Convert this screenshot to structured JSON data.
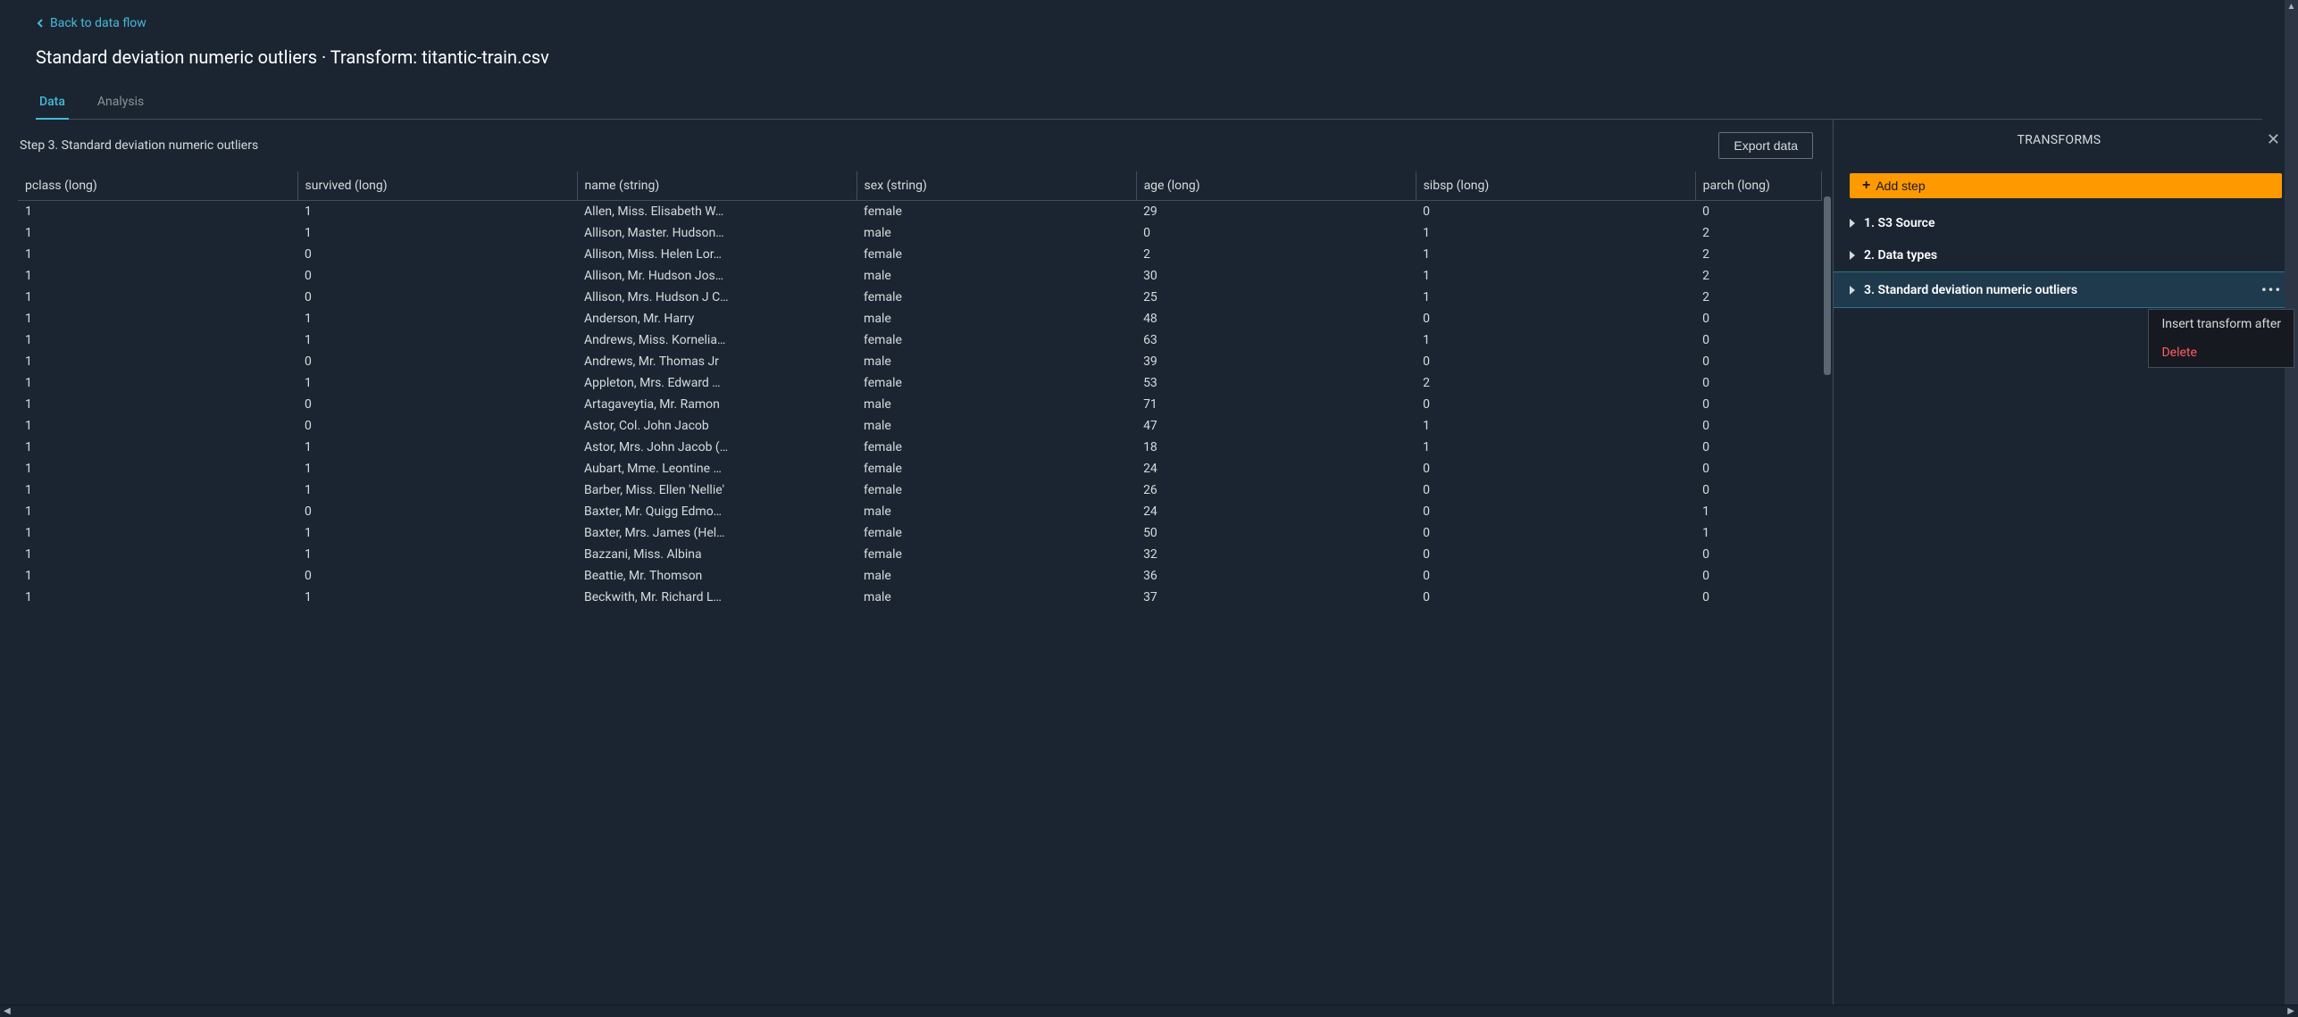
{
  "back_label": "Back to data flow",
  "page_title": "Standard deviation numeric outliers · Transform: titantic-train.csv",
  "tabs": {
    "data": "Data",
    "analysis": "Analysis"
  },
  "step_heading": "Step 3. Standard deviation numeric outliers",
  "buttons": {
    "export": "Export data",
    "add_step": "Add step"
  },
  "transforms_title": "TRANSFORMS",
  "steps": [
    {
      "label": "1. S3 Source"
    },
    {
      "label": "2. Data types"
    },
    {
      "label": "3. Standard deviation numeric outliers"
    }
  ],
  "context_menu": {
    "insert": "Insert transform after",
    "delete": "Delete"
  },
  "columns": [
    "pclass (long)",
    "survived (long)",
    "name (string)",
    "sex (string)",
    "age (long)",
    "sibsp (long)",
    "parch (long)"
  ],
  "rows": [
    {
      "pclass": "1",
      "survived": "1",
      "name": "Allen, Miss. Elisabeth W…",
      "sex": "female",
      "age": "29",
      "sibsp": "0",
      "parch": "0"
    },
    {
      "pclass": "1",
      "survived": "1",
      "name": "Allison, Master. Hudson…",
      "sex": "male",
      "age": "0",
      "sibsp": "1",
      "parch": "2"
    },
    {
      "pclass": "1",
      "survived": "0",
      "name": "Allison, Miss. Helen Lor…",
      "sex": "female",
      "age": "2",
      "sibsp": "1",
      "parch": "2"
    },
    {
      "pclass": "1",
      "survived": "0",
      "name": "Allison, Mr. Hudson Jos…",
      "sex": "male",
      "age": "30",
      "sibsp": "1",
      "parch": "2"
    },
    {
      "pclass": "1",
      "survived": "0",
      "name": "Allison, Mrs. Hudson J C…",
      "sex": "female",
      "age": "25",
      "sibsp": "1",
      "parch": "2"
    },
    {
      "pclass": "1",
      "survived": "1",
      "name": "Anderson, Mr. Harry",
      "sex": "male",
      "age": "48",
      "sibsp": "0",
      "parch": "0"
    },
    {
      "pclass": "1",
      "survived": "1",
      "name": "Andrews, Miss. Kornelia…",
      "sex": "female",
      "age": "63",
      "sibsp": "1",
      "parch": "0"
    },
    {
      "pclass": "1",
      "survived": "0",
      "name": "Andrews, Mr. Thomas Jr",
      "sex": "male",
      "age": "39",
      "sibsp": "0",
      "parch": "0"
    },
    {
      "pclass": "1",
      "survived": "1",
      "name": "Appleton, Mrs. Edward …",
      "sex": "female",
      "age": "53",
      "sibsp": "2",
      "parch": "0"
    },
    {
      "pclass": "1",
      "survived": "0",
      "name": "Artagaveytia, Mr. Ramon",
      "sex": "male",
      "age": "71",
      "sibsp": "0",
      "parch": "0"
    },
    {
      "pclass": "1",
      "survived": "0",
      "name": "Astor, Col. John Jacob",
      "sex": "male",
      "age": "47",
      "sibsp": "1",
      "parch": "0"
    },
    {
      "pclass": "1",
      "survived": "1",
      "name": "Astor, Mrs. John Jacob (…",
      "sex": "female",
      "age": "18",
      "sibsp": "1",
      "parch": "0"
    },
    {
      "pclass": "1",
      "survived": "1",
      "name": "Aubart, Mme. Leontine …",
      "sex": "female",
      "age": "24",
      "sibsp": "0",
      "parch": "0"
    },
    {
      "pclass": "1",
      "survived": "1",
      "name": "Barber, Miss. Ellen 'Nellie'",
      "sex": "female",
      "age": "26",
      "sibsp": "0",
      "parch": "0"
    },
    {
      "pclass": "1",
      "survived": "0",
      "name": "Baxter, Mr. Quigg Edmo…",
      "sex": "male",
      "age": "24",
      "sibsp": "0",
      "parch": "1"
    },
    {
      "pclass": "1",
      "survived": "1",
      "name": "Baxter, Mrs. James (Hel…",
      "sex": "female",
      "age": "50",
      "sibsp": "0",
      "parch": "1"
    },
    {
      "pclass": "1",
      "survived": "1",
      "name": "Bazzani, Miss. Albina",
      "sex": "female",
      "age": "32",
      "sibsp": "0",
      "parch": "0"
    },
    {
      "pclass": "1",
      "survived": "0",
      "name": "Beattie, Mr. Thomson",
      "sex": "male",
      "age": "36",
      "sibsp": "0",
      "parch": "0"
    },
    {
      "pclass": "1",
      "survived": "1",
      "name": "Beckwith, Mr. Richard L…",
      "sex": "male",
      "age": "37",
      "sibsp": "0",
      "parch": "0"
    }
  ]
}
